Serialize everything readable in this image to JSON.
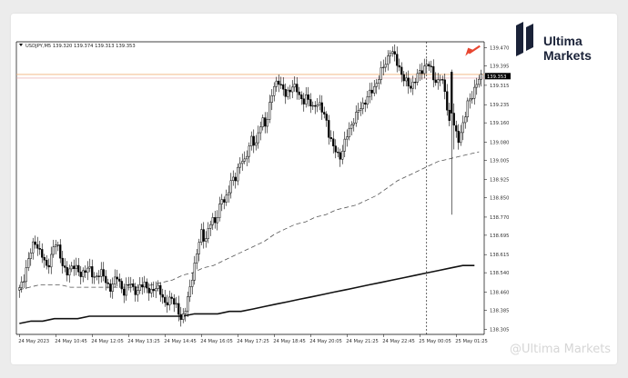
{
  "brand": {
    "name_line1": "Ultima",
    "name_line2": "Markets",
    "watermark": "@Ultima Markets"
  },
  "colors": {
    "background": "#ececec",
    "panel": "#ffffff",
    "candle": "#000000",
    "ma_long": "#111111",
    "ma_dashed": "#555555",
    "resistance_line": "#f0b27a",
    "price_line": "#e8a0a0",
    "arrow": "#e8452f",
    "logo_navy": "#1a2238",
    "current_price_bg": "#000000"
  },
  "chart_data": {
    "type": "candlestick",
    "symbol_header": "USDJPY,M5  139.320 139.374 139.313 139.353",
    "current_price_label": "139.353",
    "y_ticks": [
      "139.470",
      "139.395",
      "139.315",
      "139.235",
      "139.160",
      "139.080",
      "139.005",
      "138.925",
      "138.850",
      "138.770",
      "138.695",
      "138.615",
      "138.540",
      "138.460",
      "138.385",
      "138.305"
    ],
    "y_tick_values": [
      139.47,
      139.395,
      139.315,
      139.235,
      139.16,
      139.08,
      139.005,
      138.925,
      138.85,
      138.77,
      138.695,
      138.615,
      138.54,
      138.46,
      138.385,
      138.305
    ],
    "ylim": [
      138.305,
      139.5
    ],
    "x_ticks": [
      "24 May 2023",
      "24 May 10:45",
      "24 May 12:05",
      "24 May 13:25",
      "24 May 14:45",
      "24 May 16:05",
      "24 May 17:25",
      "24 May 18:45",
      "24 May 20:05",
      "24 May 21:25",
      "24 May 22:45",
      "25 May 00:05",
      "25 May 01:25"
    ],
    "x_tick_index": [
      0,
      16,
      32,
      48,
      64,
      80,
      96,
      112,
      128,
      144,
      160,
      176,
      192
    ],
    "n_bars": 204,
    "closes": [
      138.47,
      138.5,
      138.56,
      138.61,
      138.65,
      138.67,
      138.63,
      138.6,
      138.56,
      138.59,
      138.64,
      138.66,
      138.62,
      138.57,
      138.53,
      138.55,
      138.58,
      138.56,
      138.52,
      138.54,
      138.57,
      138.55,
      138.51,
      138.53,
      138.55,
      138.52,
      138.49,
      138.48,
      138.5,
      138.52,
      138.49,
      138.46,
      138.48,
      138.5,
      138.47,
      138.46,
      138.48,
      138.5,
      138.48,
      138.45,
      138.47,
      138.49,
      138.46,
      138.4,
      138.42,
      138.45,
      138.41,
      138.38,
      138.35,
      138.38,
      138.43,
      138.5,
      138.58,
      138.65,
      138.7,
      138.67,
      138.72,
      138.76,
      138.74,
      138.8,
      138.85,
      138.82,
      138.88,
      138.94,
      138.92,
      138.97,
      139.02,
      139.0,
      139.05,
      139.1,
      139.07,
      139.12,
      139.17,
      139.15,
      139.22,
      139.28,
      139.32,
      139.34,
      139.3,
      139.27,
      139.29,
      139.32,
      139.3,
      139.27,
      139.25,
      139.27,
      139.24,
      139.22,
      139.25,
      139.23,
      139.2,
      139.18,
      139.1,
      139.06,
      139.04,
      139.02,
      139.05,
      139.1,
      139.14,
      139.17,
      139.19,
      139.22,
      139.24,
      139.26,
      139.28,
      139.3,
      139.33,
      139.36,
      139.39,
      139.42,
      139.46,
      139.44,
      139.41,
      139.38,
      139.34,
      139.32,
      139.31,
      139.33,
      139.35,
      139.37,
      139.39,
      139.41,
      139.38,
      139.34,
      139.33,
      139.35,
      139.3,
      139.22,
      139.12,
      139.15,
      139.08,
      139.13,
      139.17,
      139.24,
      139.27,
      139.3,
      139.33,
      139.35
    ],
    "notes": "Closes are an approximate reading; the remaining bars are filled by the drawing script from the visible path of the chart.",
    "series": [
      {
        "type": "sma_dashed",
        "values": [
          138.47,
          138.48,
          138.49,
          138.49,
          138.49,
          138.48,
          138.48,
          138.48,
          138.48,
          138.48,
          138.48,
          138.48,
          138.48,
          138.49,
          138.5,
          138.51,
          138.53,
          138.54,
          138.56,
          138.57,
          138.59,
          138.61,
          138.63,
          138.65,
          138.67,
          138.7,
          138.72,
          138.74,
          138.75,
          138.77,
          138.78,
          138.8,
          138.81,
          138.82,
          138.84,
          138.86,
          138.89,
          138.92,
          138.94,
          138.96,
          138.98,
          139.0,
          139.01,
          139.02,
          139.03,
          139.04
        ]
      },
      {
        "type": "sma_solid",
        "values": [
          138.33,
          138.34,
          138.34,
          138.35,
          138.35,
          138.35,
          138.36,
          138.36,
          138.36,
          138.36,
          138.36,
          138.36,
          138.36,
          138.36,
          138.36,
          138.37,
          138.37,
          138.37,
          138.38,
          138.38,
          138.39,
          138.4,
          138.41,
          138.42,
          138.43,
          138.44,
          138.45,
          138.46,
          138.47,
          138.48,
          138.49,
          138.5,
          138.51,
          138.52,
          138.53,
          138.54,
          138.55,
          138.56,
          138.57,
          138.57
        ]
      }
    ],
    "horizontal_lines": [
      139.36,
      139.345
    ],
    "vertical_marker_index": 179,
    "arrow_annotation": {
      "direction": "down-left",
      "near_index": 196,
      "near_price": 139.44
    }
  }
}
